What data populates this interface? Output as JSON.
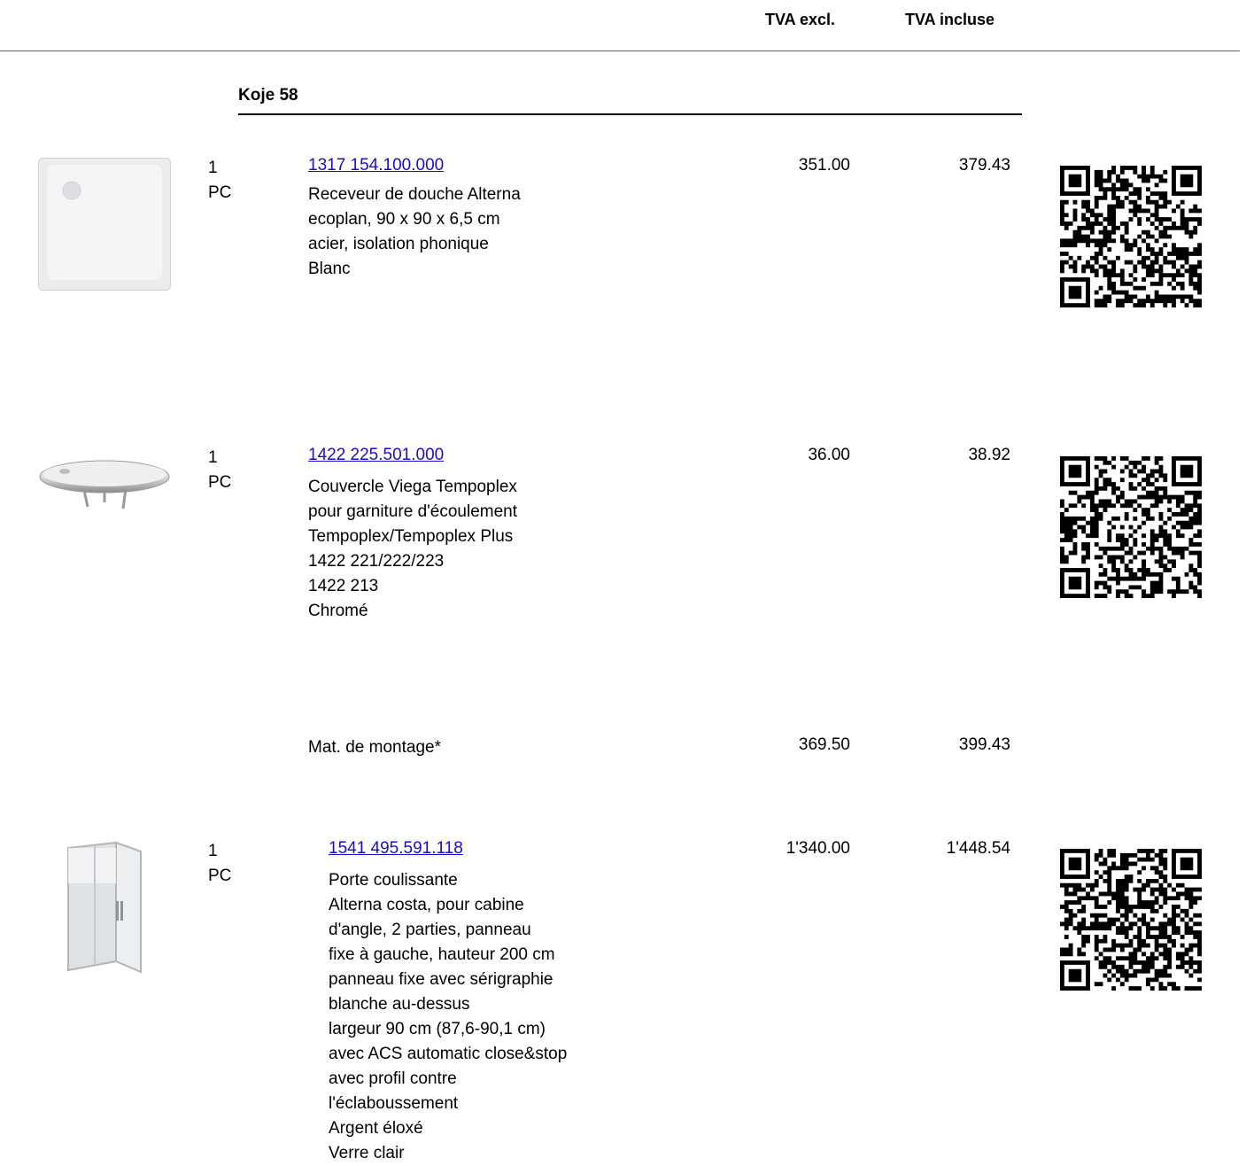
{
  "header": {
    "col_excl": "TVA excl.",
    "col_incl": "TVA incluse"
  },
  "section": {
    "title": "Koje 58"
  },
  "items": [
    {
      "qty": "1",
      "unit": "PC",
      "article": "1317 154.100.000",
      "description": [
        "Receveur de douche Alterna",
        "ecoplan, 90 x 90 x 6,5 cm",
        "acier, isolation phonique",
        "Blanc"
      ],
      "price_excl": "351.00",
      "price_incl": "379.43"
    },
    {
      "qty": "1",
      "unit": "PC",
      "article": "1422 225.501.000",
      "description": [
        "Couvercle Viega Tempoplex",
        "pour garniture d'écoulement",
        "Tempoplex/Tempoplex Plus",
        "1422 221/222/223",
        "1422 213",
        "Chromé"
      ],
      "price_excl": "36.00",
      "price_incl": "38.92"
    },
    {
      "qty": "1",
      "unit": "PC",
      "article": "1541 495.591.118",
      "description": [
        "Porte coulissante",
        "Alterna costa, pour cabine",
        "d'angle, 2 parties, panneau",
        "fixe à gauche, hauteur 200 cm",
        "panneau fixe avec sérigraphie",
        "blanche au-dessus",
        "largeur 90 cm (87,6-90,1 cm)",
        "avec ACS automatic close&stop",
        "avec profil contre",
        "l'éclaboussement",
        "Argent éloxé",
        "Verre clair"
      ],
      "price_excl": "1'340.00",
      "price_incl": "1'448.54"
    }
  ],
  "mounting": {
    "label": "Mat. de montage*",
    "price_excl": "369.50",
    "price_incl": "399.43"
  },
  "colors": {
    "link": "#1a0dcc",
    "rule": "#000000"
  }
}
